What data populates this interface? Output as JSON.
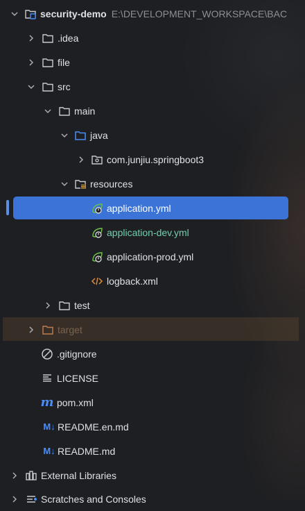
{
  "project": {
    "name": "security-demo",
    "path": "E:\\DEVELOPMENT_WORKSPACE\\BAC"
  },
  "tree": {
    "idea": ".idea",
    "file": "file",
    "src": "src",
    "main": "main",
    "java": "java",
    "package": "com.junjiu.springboot3",
    "resources": "resources",
    "app_yml": "application.yml",
    "app_dev_yml": "application-dev.yml",
    "app_prod_yml": "application-prod.yml",
    "logback": "logback.xml",
    "test": "test",
    "target": "target",
    "gitignore": ".gitignore",
    "license": "LICENSE",
    "pom": "pom.xml",
    "readme_en": "README.en.md",
    "readme": "README.md",
    "external_libraries": "External Libraries",
    "scratches": "Scratches and Consoles"
  },
  "icons": {
    "markdown_glyph": "M↓",
    "maven_glyph": "m"
  },
  "colors": {
    "selection": "#3b73d6",
    "modified_file": "#6fcfae",
    "excluded_folder": "#c27d4e",
    "source_root": "#4a8df7"
  }
}
